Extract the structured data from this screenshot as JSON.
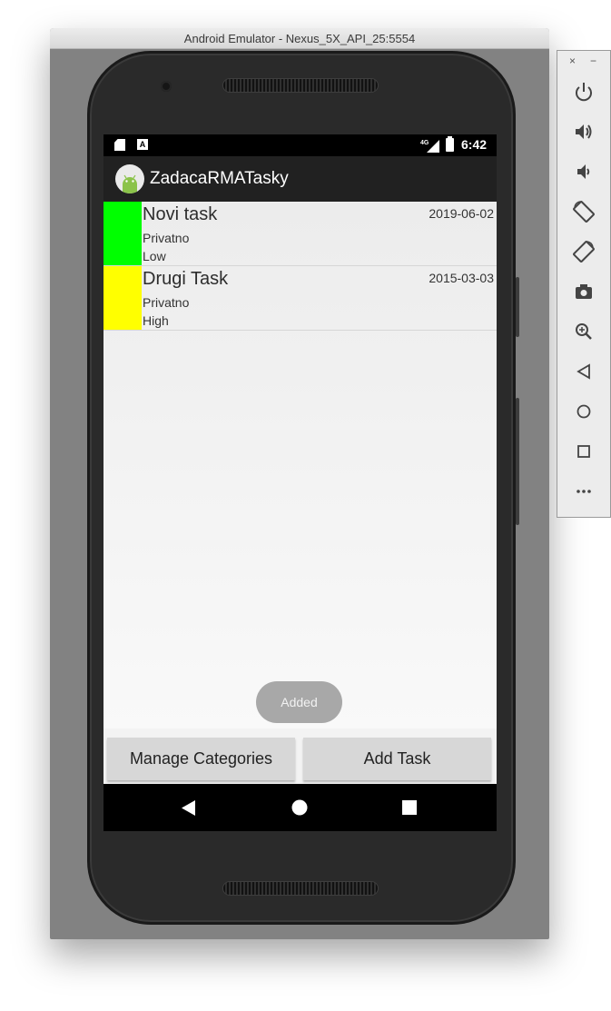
{
  "window": {
    "title": "Android Emulator - Nexus_5X_API_25:5554"
  },
  "status_bar": {
    "a_icon": "A",
    "network": "4G",
    "time": "6:42"
  },
  "app": {
    "title": "ZadacaRMATasky"
  },
  "tasks": [
    {
      "name": "Novi task",
      "date": "2019-06-02",
      "category": "Privatno",
      "priority": "Low",
      "color": "#00ff00"
    },
    {
      "name": "Drugi Task",
      "date": "2015-03-03",
      "category": "Privatno",
      "priority": "High",
      "color": "#ffff00"
    }
  ],
  "toast": {
    "text": "Added"
  },
  "buttons": {
    "manage_categories": "Manage Categories",
    "add_task": "Add Task"
  },
  "nav": {
    "back": "back-icon",
    "home": "home-icon",
    "recents": "recents-icon"
  },
  "toolbar": {
    "close": "×",
    "minimize": "−",
    "items": [
      "power-icon",
      "volume-up-icon",
      "volume-down-icon",
      "rotate-left-icon",
      "rotate-right-icon",
      "camera-icon",
      "zoom-icon",
      "back-icon",
      "home-icon",
      "overview-icon",
      "more-icon"
    ]
  }
}
